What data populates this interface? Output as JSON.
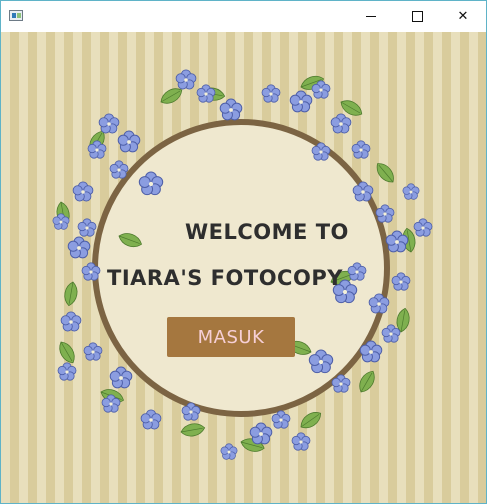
{
  "window": {
    "title": "",
    "controls": {
      "minimize_icon": "minimize-icon",
      "maximize_icon": "maximize-icon",
      "close_symbol": "✕"
    }
  },
  "welcome": {
    "line1": "WELCOME TO",
    "line2": "TIARA'S FOTOCOPY"
  },
  "button": {
    "label": "MASUK"
  },
  "colors": {
    "stripe_light": "#e8dfbc",
    "stripe_dark": "#d9cc9c",
    "circle_fill": "#efe8cf",
    "circle_ring": "#7c6443",
    "button_bg": "#a5773f",
    "button_text": "#f6cfd6",
    "flower": "#8b9de0",
    "leaf": "#7fb04f"
  }
}
